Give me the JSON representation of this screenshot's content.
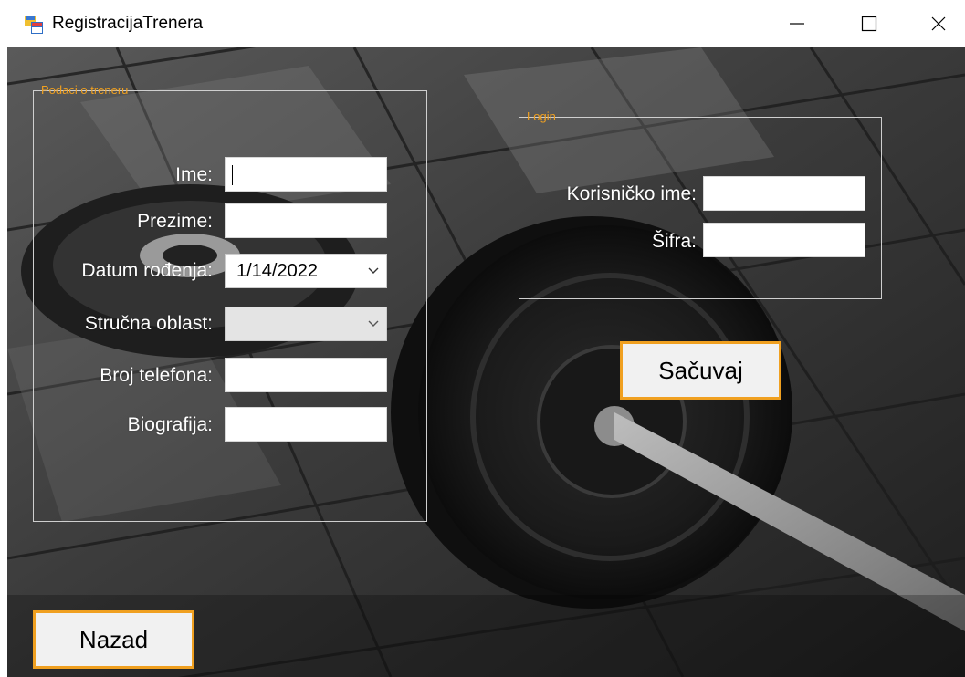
{
  "window": {
    "title": "RegistracijaTrenera"
  },
  "trener_group": {
    "title": "Podaci o treneru",
    "labels": {
      "ime": "Ime:",
      "prezime": "Prezime:",
      "datum": "Datum rođenja:",
      "oblast": "Stručna oblast:",
      "telefon": "Broj telefona:",
      "biografija": "Biografija:"
    },
    "values": {
      "ime": "",
      "prezime": "",
      "datum": "1/14/2022",
      "oblast": "",
      "telefon": "",
      "biografija": ""
    }
  },
  "login_group": {
    "title": "Login",
    "labels": {
      "korisnicko_ime": "Korisničko ime:",
      "sifra": "Šifra:"
    },
    "values": {
      "korisnicko_ime": "",
      "sifra": ""
    }
  },
  "buttons": {
    "save": "Sačuvaj",
    "back": "Nazad"
  },
  "colors": {
    "accent": "#f0a020",
    "label_text": "#ffffff",
    "groupbox_border": "#cfcfcf"
  },
  "icons": {
    "app": "app-icon",
    "minimize": "minimize-icon",
    "maximize": "maximize-icon",
    "close": "close-icon",
    "dropdown": "chevron-down-icon"
  }
}
